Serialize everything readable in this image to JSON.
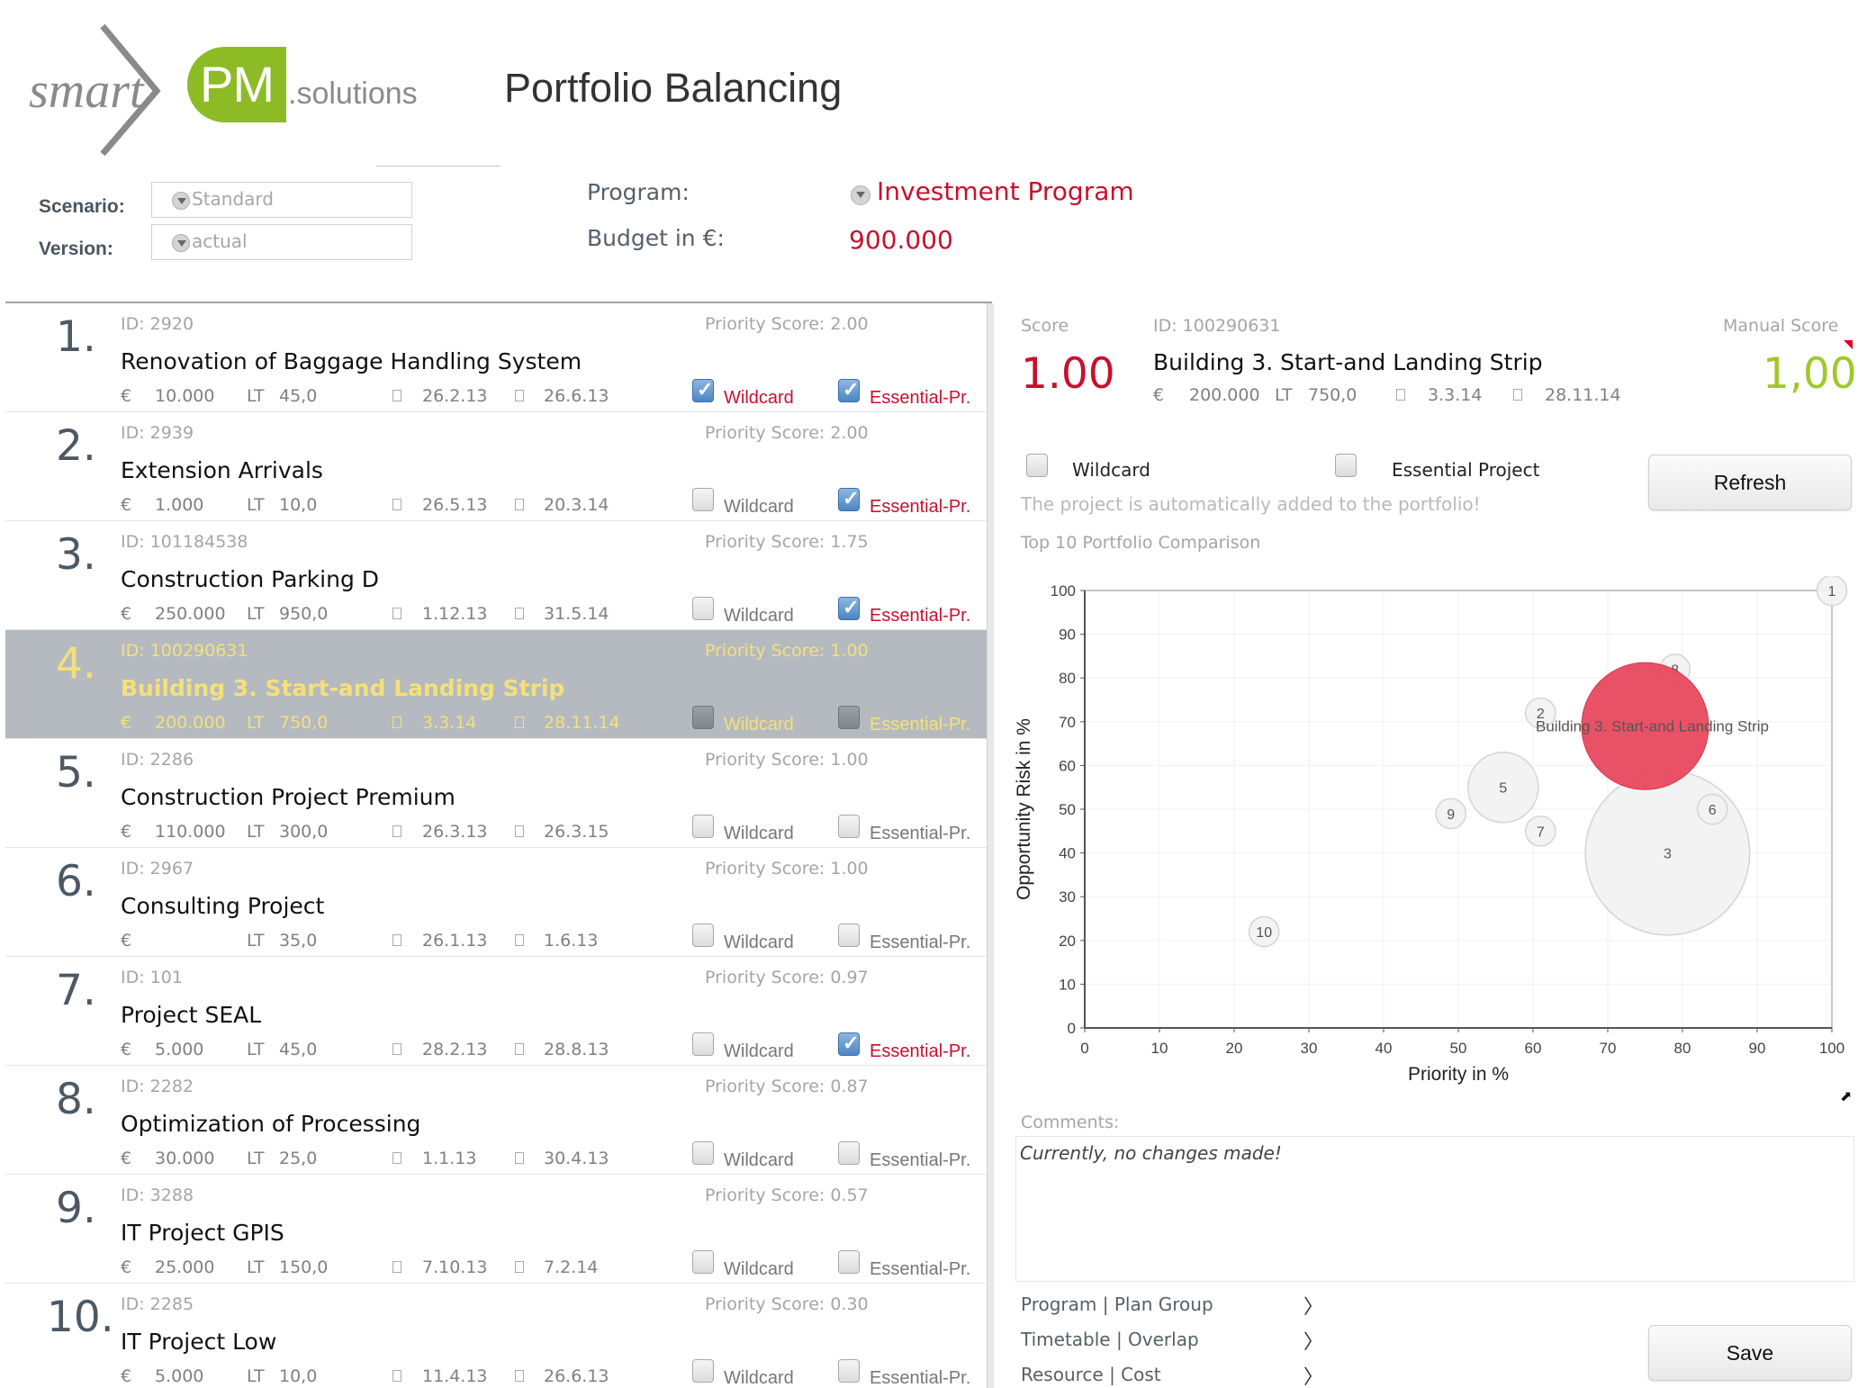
{
  "header": {
    "logo": {
      "smart": "smart",
      "pm": "PM",
      "solutions": ".solutions"
    },
    "title": "Portfolio Balancing",
    "scenario_label": "Scenario:",
    "scenario_value": "Standard",
    "version_label": "Version:",
    "version_value": "actual",
    "program_label": "Program:",
    "program_value": "Investment Program",
    "budget_label": "Budget in €:",
    "budget_value": "900.000"
  },
  "list": {
    "wildcard_label": "Wildcard",
    "essential_label": "Essential-Pr.",
    "items": [
      {
        "rank": "1.",
        "id": "ID: 2920",
        "priority": "Priority Score: 2.00",
        "name": "Renovation of Baggage Handling System",
        "cost": "10.000",
        "lt": "45,0",
        "start": "26.2.13",
        "end": "26.6.13",
        "wildcard": true,
        "essential": true
      },
      {
        "rank": "2.",
        "id": "ID: 2939",
        "priority": "Priority Score: 2.00",
        "name": "Extension Arrivals",
        "cost": "1.000",
        "lt": "10,0",
        "start": "26.5.13",
        "end": "20.3.14",
        "wildcard": false,
        "essential": true
      },
      {
        "rank": "3.",
        "id": "ID: 101184538",
        "priority": "Priority Score: 1.75",
        "name": "Construction Parking D",
        "cost": "250.000",
        "lt": "950,0",
        "start": "1.12.13",
        "end": "31.5.14",
        "wildcard": false,
        "essential": true
      },
      {
        "rank": "4.",
        "id": "ID: 100290631",
        "priority": "Priority Score: 1.00",
        "name": "Building 3. Start-and Landing Strip",
        "cost": "200.000",
        "lt": "750,0",
        "start": "3.3.14",
        "end": "28.11.14",
        "wildcard": false,
        "essential": false,
        "selected": true
      },
      {
        "rank": "5.",
        "id": "ID: 2286",
        "priority": "Priority Score: 1.00",
        "name": "Construction Project Premium",
        "cost": "110.000",
        "lt": "300,0",
        "start": "26.3.13",
        "end": "26.3.15",
        "wildcard": false,
        "essential": false
      },
      {
        "rank": "6.",
        "id": "ID: 2967",
        "priority": "Priority Score: 1.00",
        "name": "Consulting Project",
        "cost": "",
        "lt": "35,0",
        "start": "26.1.13",
        "end": "1.6.13",
        "wildcard": false,
        "essential": false
      },
      {
        "rank": "7.",
        "id": "ID: 101",
        "priority": "Priority Score: 0.97",
        "name": "Project SEAL",
        "cost": "5.000",
        "lt": "45,0",
        "start": "28.2.13",
        "end": "28.8.13",
        "wildcard": false,
        "essential": true
      },
      {
        "rank": "8.",
        "id": "ID: 2282",
        "priority": "Priority Score: 0.87",
        "name": "Optimization of Processing",
        "cost": "30.000",
        "lt": "25,0",
        "start": "1.1.13",
        "end": "30.4.13",
        "wildcard": false,
        "essential": false
      },
      {
        "rank": "9.",
        "id": "ID: 3288",
        "priority": "Priority Score: 0.57",
        "name": "IT Project GPIS",
        "cost": "25.000",
        "lt": "150,0",
        "start": "7.10.13",
        "end": "7.2.14",
        "wildcard": false,
        "essential": false
      },
      {
        "rank": "10.",
        "id": "ID: 2285",
        "priority": "Priority Score: 0.30",
        "name": "IT Project Low",
        "cost": "5.000",
        "lt": "10,0",
        "start": "11.4.13",
        "end": "26.6.13",
        "wildcard": false,
        "essential": false
      }
    ]
  },
  "detail": {
    "score_label": "Score",
    "score_value": "1.00",
    "id": "ID: 100290631",
    "manual_score_label": "Manual Score",
    "manual_score_value": "1,00",
    "name": "Building 3. Start-and Landing Strip",
    "currency": "€",
    "cost": "200.000",
    "lt_label": "LT",
    "lt": "750,0",
    "start": "3.3.14",
    "end": "28.11.14",
    "wildcard_label": "Wildcard",
    "wildcard_checked": false,
    "essential_label": "Essential Project",
    "essential_checked": false,
    "refresh_label": "Refresh",
    "auto_added_note": "The project is automatically added to the portfolio!",
    "comparison_title": "Top 10 Portfolio Comparison",
    "comments_label": "Comments:",
    "comments_value": "Currently, no changes made!",
    "nav_links": [
      {
        "label": "Program | Plan Group",
        "icon": "chevron-right-icon"
      },
      {
        "label": "Timetable | Overlap",
        "icon": "chevron-right-icon"
      },
      {
        "label": "Resource | Cost",
        "icon": "chevron-right-icon"
      }
    ],
    "save_label": "Save"
  },
  "colors": {
    "accent_red": "#c8102e",
    "brand_green": "#8cbb26",
    "manual_green": "#9fc92a",
    "selected_row": "#b5bac1",
    "selected_text": "#f5e079",
    "highlight_bubble": "#e8495e"
  },
  "chart_data": {
    "type": "scatter",
    "subtype": "bubble",
    "title": "Top 10 Portfolio Comparison",
    "xlabel": "Priority in %",
    "ylabel": "Opportunity Risk in %",
    "xlim": [
      0,
      100
    ],
    "ylim": [
      0,
      100
    ],
    "xticks": [
      0,
      10,
      20,
      30,
      40,
      50,
      60,
      70,
      80,
      90,
      100
    ],
    "yticks": [
      0,
      10,
      20,
      30,
      40,
      50,
      60,
      70,
      80,
      90,
      100
    ],
    "grid": true,
    "points": [
      {
        "label": "1",
        "x": 100,
        "y": 100,
        "size": 2
      },
      {
        "label": "2",
        "x": 61,
        "y": 72,
        "size": 2
      },
      {
        "label": "3",
        "x": 78,
        "y": 40,
        "size": 11
      },
      {
        "label": "Building 3. Start-and Landing Strip",
        "x": 75,
        "y": 69,
        "size": 8.5,
        "highlight": true
      },
      {
        "label": "5",
        "x": 56,
        "y": 55,
        "size": 4.7
      },
      {
        "label": "6",
        "x": 84,
        "y": 50,
        "size": 2
      },
      {
        "label": "7",
        "x": 61,
        "y": 45,
        "size": 2
      },
      {
        "label": "8",
        "x": 79,
        "y": 82,
        "size": 2
      },
      {
        "label": "9",
        "x": 49,
        "y": 49,
        "size": 2
      },
      {
        "label": "10",
        "x": 24,
        "y": 22,
        "size": 2
      }
    ]
  }
}
